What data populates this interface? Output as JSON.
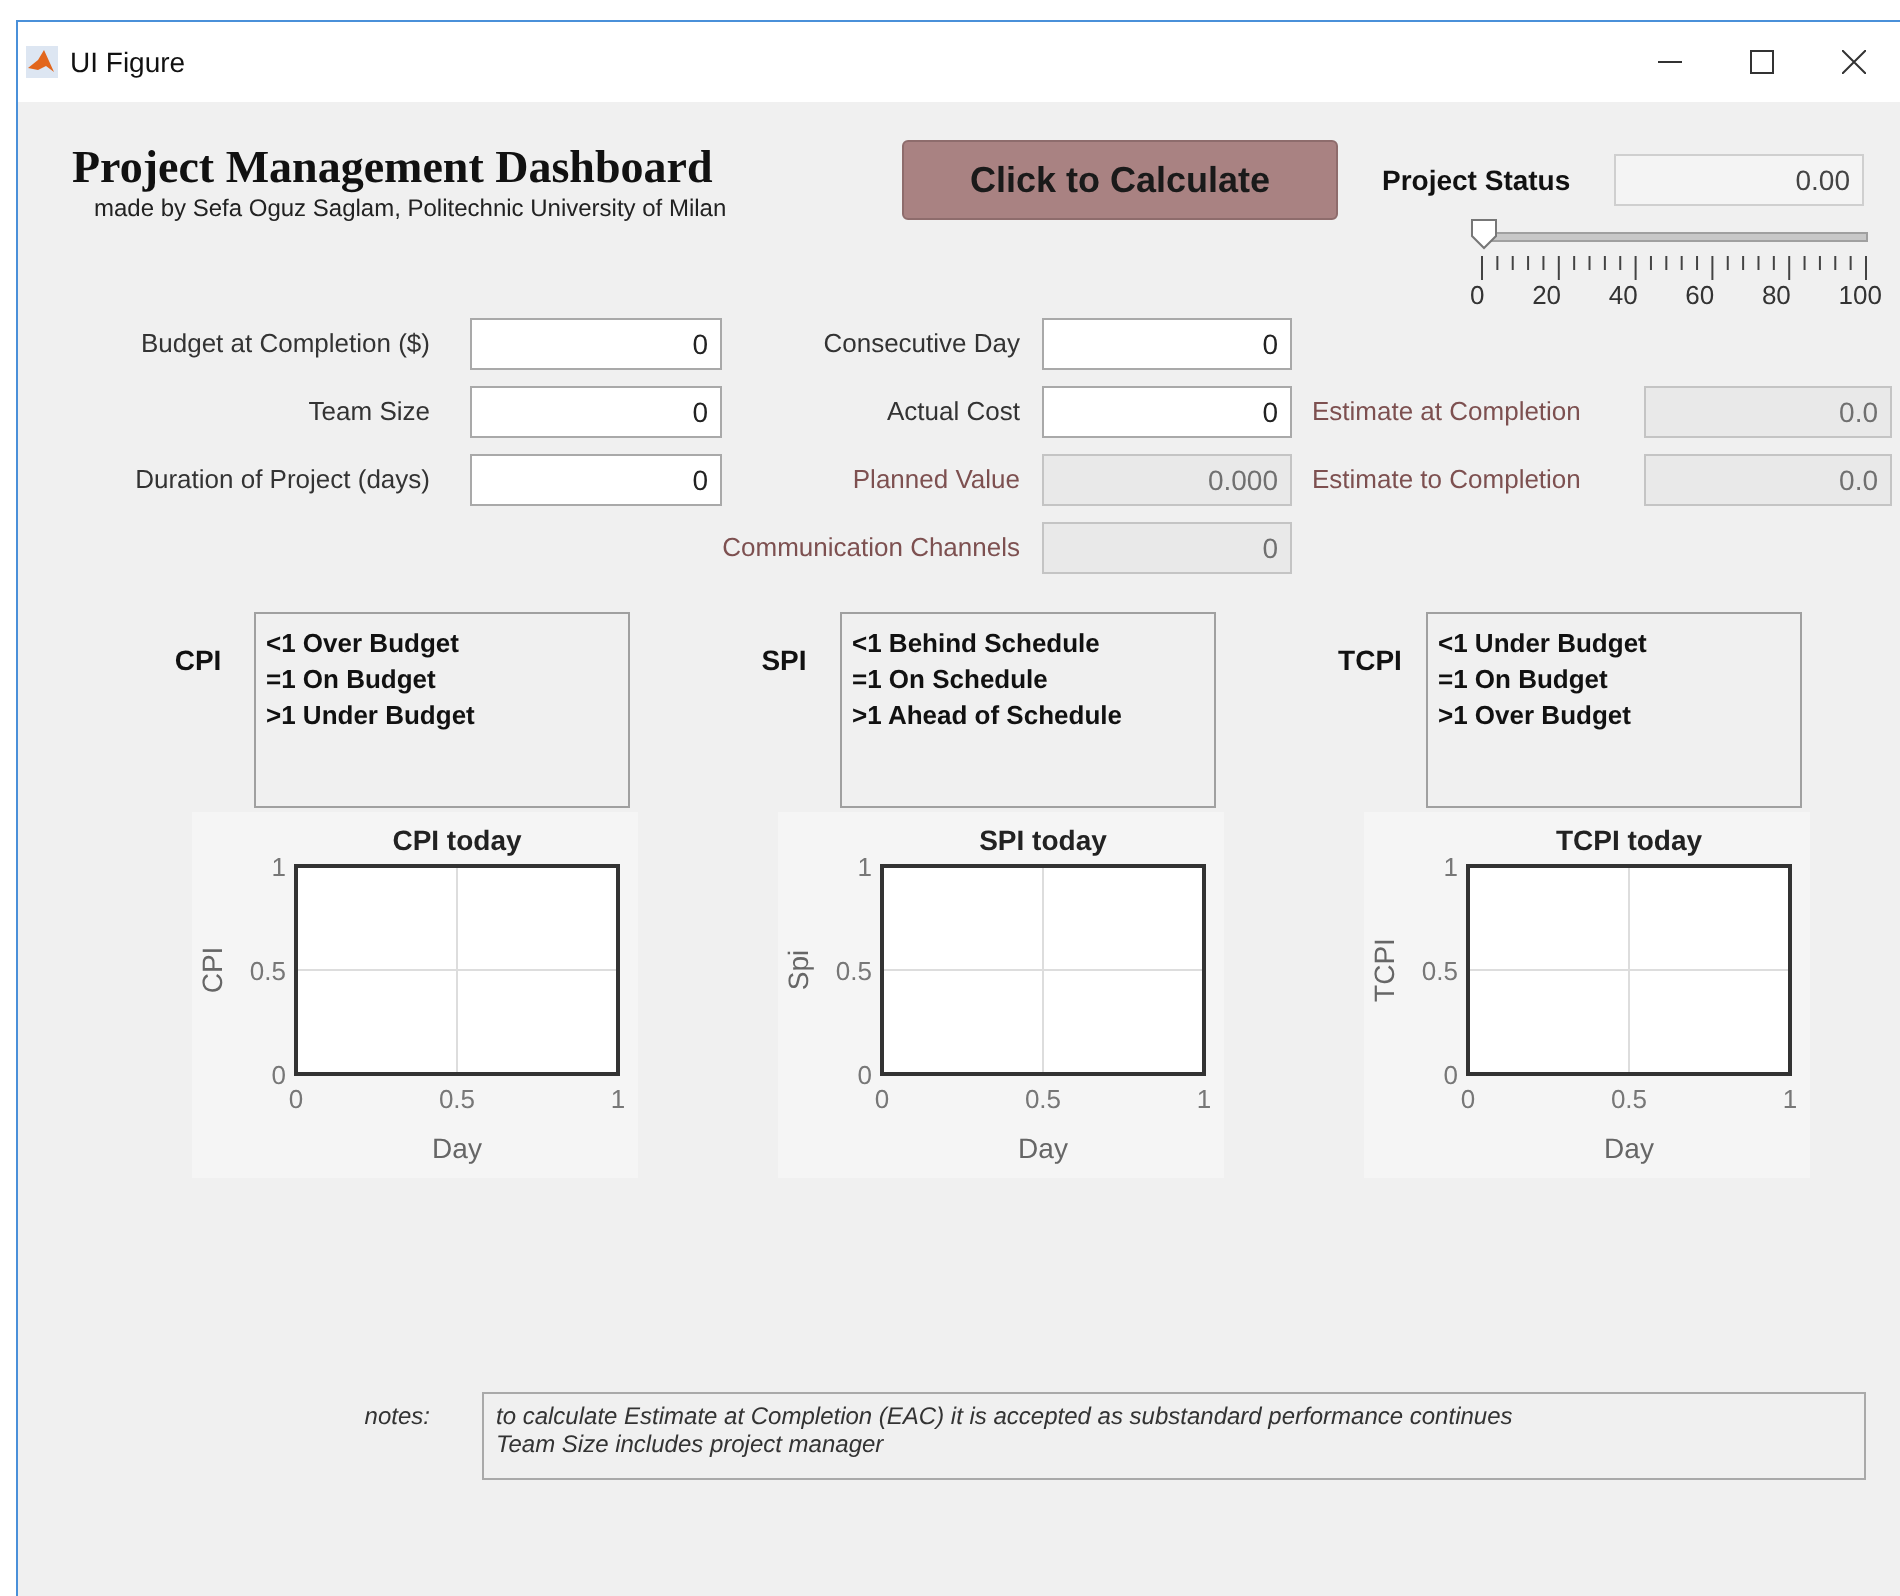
{
  "window": {
    "title": "UI Figure"
  },
  "header": {
    "title": "Project Management Dashboard",
    "subtitle": "made by Sefa Oguz Saglam, Politechnic University of Milan",
    "button": "Click to Calculate"
  },
  "status": {
    "label": "Project Status",
    "value": "0.00",
    "level": 0,
    "ticks": [
      "0",
      "20",
      "40",
      "60",
      "80",
      "100"
    ]
  },
  "form_rows": [
    {
      "left": {
        "label": "Budget at Completion ($)",
        "value": "0",
        "editable": true
      },
      "middle": {
        "label": "Consecutive Day",
        "value": "0",
        "editable": true
      }
    },
    {
      "left": {
        "label": "Team Size",
        "value": "0",
        "editable": true
      },
      "middle": {
        "label": "Actual Cost",
        "value": "0",
        "editable": true
      },
      "right": {
        "label": "Estimate at Completion",
        "value": "0.0",
        "editable": false
      }
    },
    {
      "left": {
        "label": "Duration of Project (days)",
        "value": "0",
        "editable": true
      },
      "middle": {
        "label": "Planned Value",
        "value": "0.000",
        "editable": false
      },
      "right": {
        "label": "Estimate to Completion",
        "value": "0.0",
        "editable": false
      }
    },
    {
      "middle": {
        "label": "Communication Channels",
        "value": "0",
        "editable": false
      }
    }
  ],
  "indicators": [
    {
      "label": "CPI",
      "legend": [
        "<1 Over Budget",
        "=1 On Budget",
        ">1 Under Budget"
      ],
      "chart_data": {
        "type": "line",
        "title": "CPI today",
        "xlabel": "Day",
        "ylabel": "CPI",
        "xlim": [
          0,
          1
        ],
        "ylim": [
          0,
          1
        ],
        "xticks": [
          0,
          0.5,
          1
        ],
        "yticks": [
          0,
          0.5,
          1
        ]
      }
    },
    {
      "label": "SPI",
      "legend": [
        "<1 Behind Schedule",
        "=1 On Schedule",
        ">1 Ahead of Schedule"
      ],
      "chart_data": {
        "type": "line",
        "title": "SPI today",
        "xlabel": "Day",
        "ylabel": "Spi",
        "xlim": [
          0,
          1
        ],
        "ylim": [
          0,
          1
        ],
        "xticks": [
          0,
          0.5,
          1
        ],
        "yticks": [
          0,
          0.5,
          1
        ]
      }
    },
    {
      "label": "TCPI",
      "legend": [
        "<1 Under Budget",
        "=1 On Budget",
        ">1 Over Budget"
      ],
      "chart_data": {
        "type": "line",
        "title": "TCPI today",
        "xlabel": "Day",
        "ylabel": "TCPI",
        "xlim": [
          0,
          1
        ],
        "ylim": [
          0,
          1
        ],
        "xticks": [
          0,
          0.5,
          1
        ],
        "yticks": [
          0,
          0.5,
          1
        ]
      }
    }
  ],
  "notes": {
    "label": "notes:",
    "lines": [
      "to calculate Estimate at Completion (EAC) it is accepted as substandard performance continues",
      "Team Size includes project manager"
    ]
  }
}
